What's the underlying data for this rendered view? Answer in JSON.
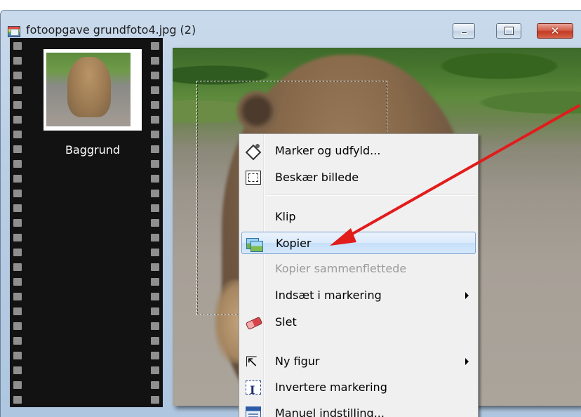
{
  "window": {
    "title": "fotoopgave grundfoto4.jpg (2)",
    "controls": {
      "minimize": "minimize",
      "maximize": "maximize",
      "close": "close"
    }
  },
  "layers": [
    {
      "label": "Baggrund"
    }
  ],
  "context_menu": {
    "items": [
      {
        "label": "Marker og udfyld...",
        "icon": "fill-icon",
        "enabled": true
      },
      {
        "label": "Beskær billede",
        "icon": "crop-icon",
        "enabled": true
      },
      {
        "label": "Klip",
        "icon": "",
        "enabled": true
      },
      {
        "label": "Kopier",
        "icon": "copy-icon",
        "enabled": true,
        "highlighted": true
      },
      {
        "label": "Kopier sammenflettede",
        "icon": "",
        "enabled": false
      },
      {
        "label": "Indsæt i markering",
        "icon": "",
        "enabled": true,
        "submenu": true
      },
      {
        "label": "Slet",
        "icon": "eraser-icon",
        "enabled": true
      },
      {
        "label": "Ny figur",
        "icon": "cursor-icon",
        "enabled": true,
        "submenu": true
      },
      {
        "label": "Invertere markering",
        "icon": "invert-selection-icon",
        "enabled": true
      },
      {
        "label": "Manuel indstilling...",
        "icon": "manual-settings-icon",
        "enabled": true
      }
    ]
  },
  "annotation": {
    "arrow_color": "#e21b1b"
  }
}
